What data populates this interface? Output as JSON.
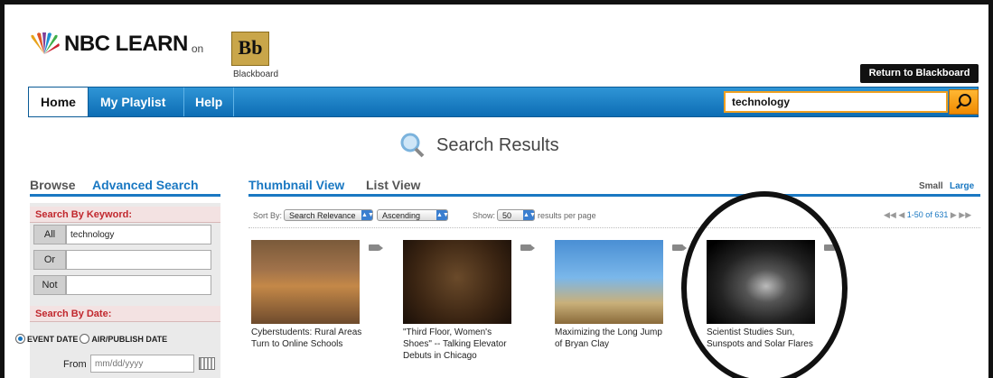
{
  "header": {
    "logo_text": "NBC LEARN",
    "logo_on": "on",
    "bb_mark": "Bb",
    "bb_label": "Blackboard",
    "return_button": "Return to Blackboard"
  },
  "nav": {
    "items": [
      {
        "label": "Home"
      },
      {
        "label": "My Playlist"
      },
      {
        "label": "Help"
      }
    ],
    "search_value": "technology",
    "search_icon": "magnifier-icon"
  },
  "results_title": "Search Results",
  "left_panel": {
    "tabs": [
      {
        "label": "Browse"
      },
      {
        "label": "Advanced Search"
      }
    ],
    "keyword_heading": "Search By Keyword:",
    "keyword_rows": [
      {
        "label": "All",
        "value": "technology"
      },
      {
        "label": "Or",
        "value": ""
      },
      {
        "label": "Not",
        "value": ""
      }
    ],
    "date_heading": "Search By Date:",
    "date_options": [
      {
        "label": "EVENT DATE",
        "selected": true
      },
      {
        "label": "AIR/PUBLISH DATE",
        "selected": false
      }
    ],
    "from_label": "From",
    "from_placeholder": "mm/dd/yyyy"
  },
  "right_panel": {
    "tabs": [
      {
        "label": "Thumbnail View"
      },
      {
        "label": "List View"
      }
    ],
    "size_small": "Small",
    "size_large": "Large",
    "sort_label": "Sort By:",
    "sort_value": "Search Relevance",
    "order_value": "Ascending",
    "show_label": "Show:",
    "show_value": "50",
    "per_page_label": "results per page",
    "pager_text": "1-50 of 631",
    "thumbnails": [
      {
        "caption": "Cyberstudents: Rural Areas Turn to Online Schools"
      },
      {
        "caption": "\"Third Floor, Women's Shoes\" -- Talking Elevator Debuts in Chicago"
      },
      {
        "caption": "Maximizing the Long Jump of Bryan Clay"
      },
      {
        "caption": "Scientist Studies Sun, Sunspots and Solar Flares"
      }
    ]
  },
  "colors": {
    "nav_blue": "#1a78c2",
    "search_orange": "#f08a00",
    "section_red": "#c1272d"
  }
}
